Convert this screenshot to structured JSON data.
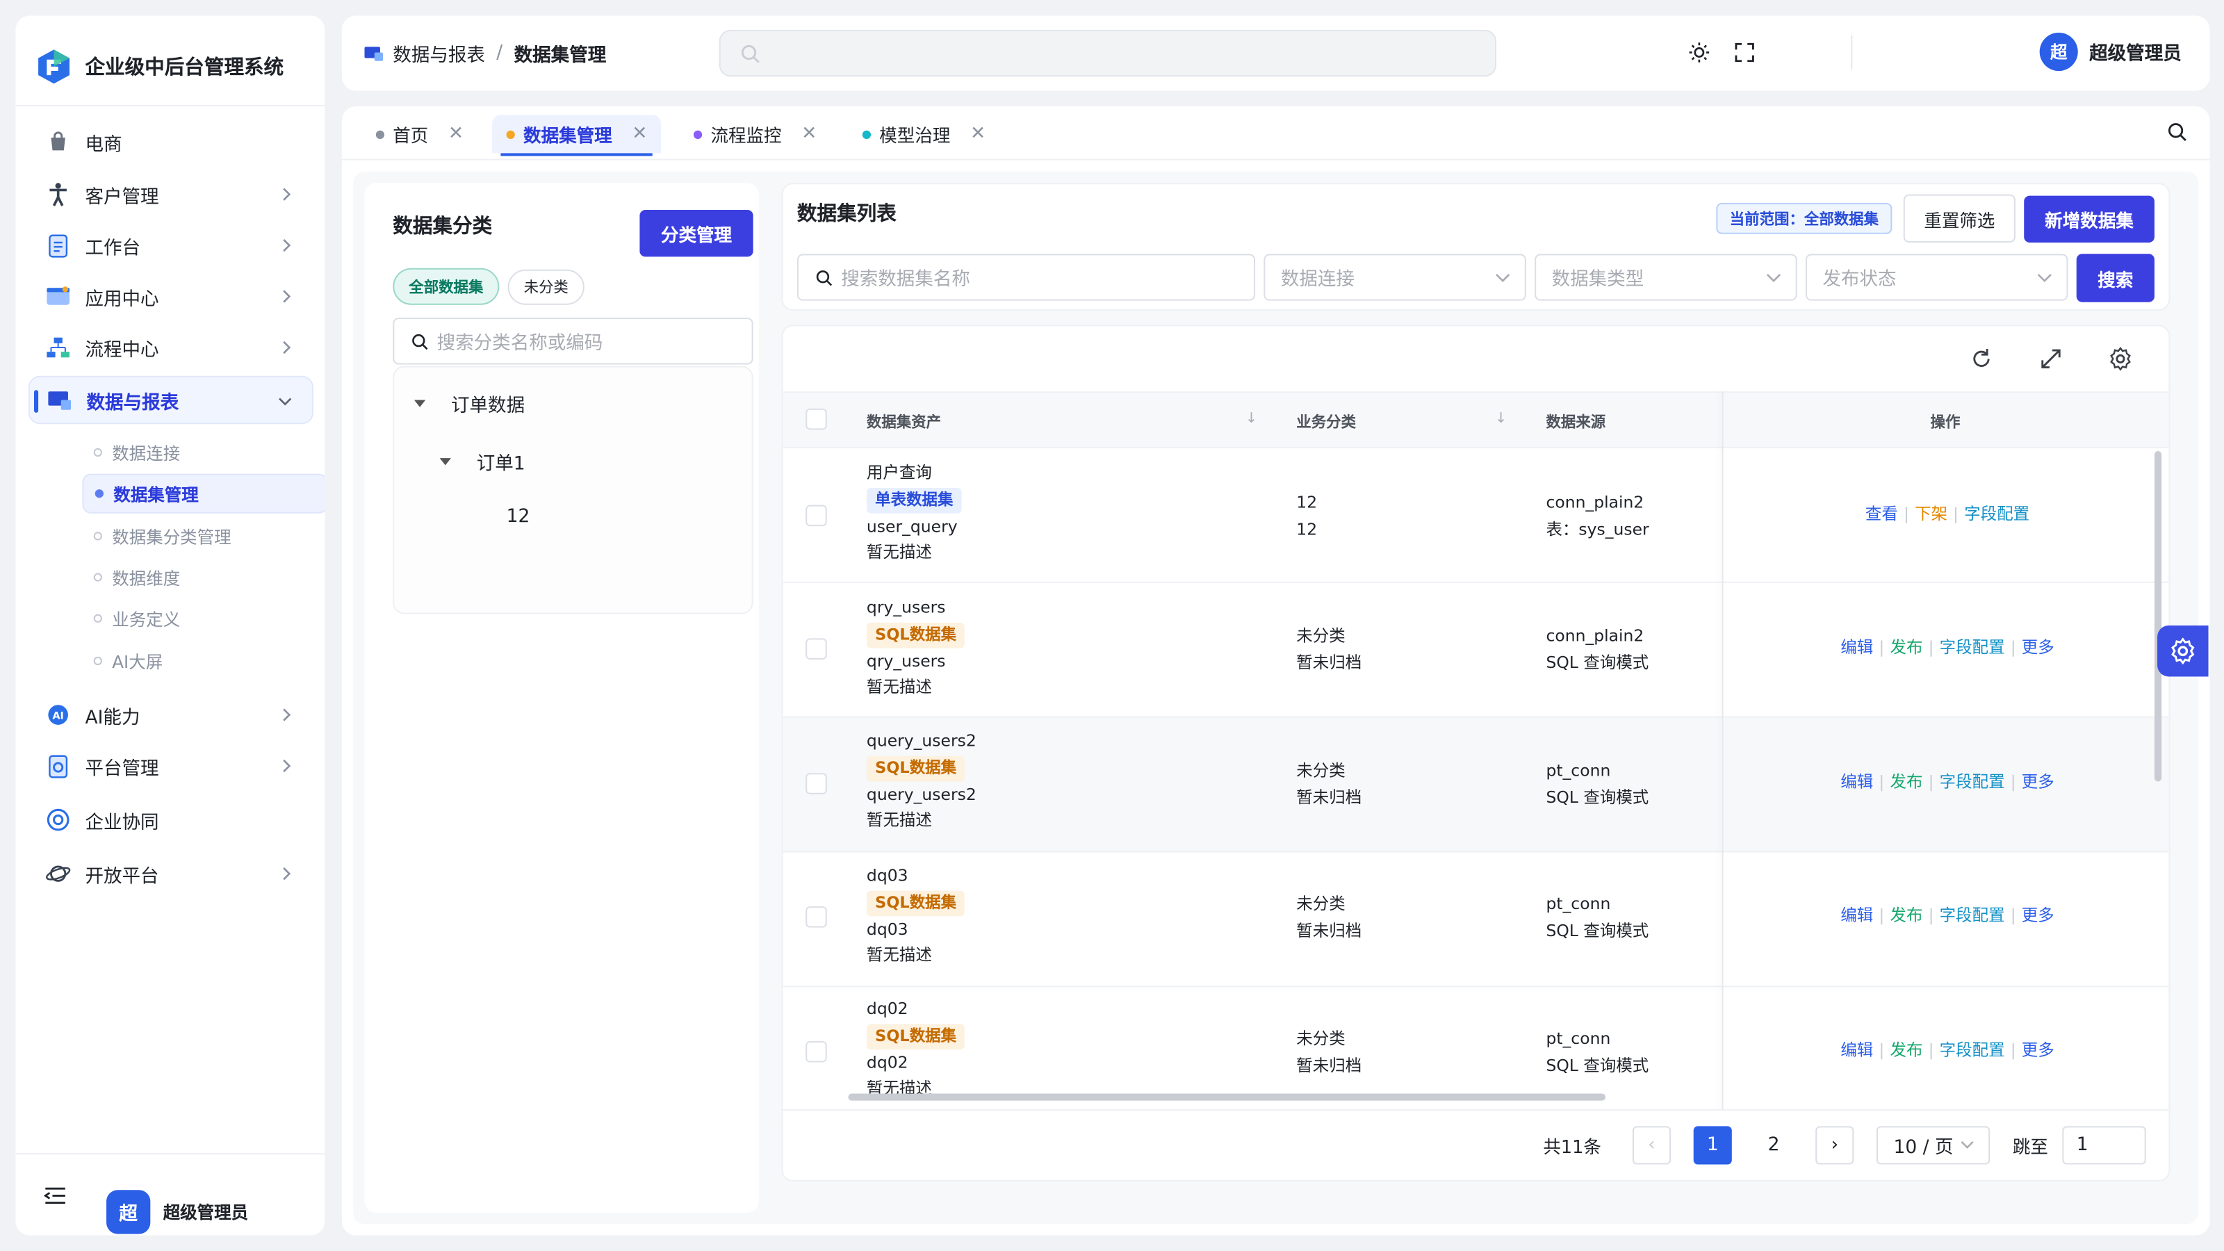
{
  "app": {
    "title": "企业级中后台管理系统",
    "user": "超级管理员",
    "avatar": "超"
  },
  "sidebar": {
    "items": [
      {
        "label": "电商",
        "icon": "shopping-bag-icon"
      },
      {
        "label": "客户管理",
        "icon": "person-icon"
      },
      {
        "label": "工作台",
        "icon": "clipboard-icon"
      },
      {
        "label": "应用中心",
        "icon": "app-window-icon"
      },
      {
        "label": "流程中心",
        "icon": "flow-icon"
      },
      {
        "label": "数据与报表",
        "icon": "report-icon"
      },
      {
        "label": "AI能力",
        "icon": "ai-icon"
      },
      {
        "label": "平台管理",
        "icon": "platform-icon"
      },
      {
        "label": "企业协同",
        "icon": "collab-icon"
      },
      {
        "label": "开放平台",
        "icon": "planet-icon"
      }
    ],
    "sub_items": [
      "数据连接",
      "数据集管理",
      "数据集分类管理",
      "数据维度",
      "业务定义",
      "AI大屏"
    ]
  },
  "header": {
    "breadcrumb": [
      "数据与报表",
      "数据集管理"
    ]
  },
  "tabs": [
    {
      "label": "首页",
      "color": "#8a919f"
    },
    {
      "label": "数据集管理",
      "color": "#f5a623"
    },
    {
      "label": "流程监控",
      "color": "#8b5cf6"
    },
    {
      "label": "模型治理",
      "color": "#14b8c8"
    }
  ],
  "category": {
    "title": "数据集分类",
    "manage_btn": "分类管理",
    "filters": [
      "全部数据集",
      "未分类"
    ],
    "search_placeholder": "搜索分类名称或编码",
    "tree": [
      "订单数据",
      "订单1",
      "12"
    ]
  },
  "list": {
    "title": "数据集列表",
    "scope": "当前范围：全部数据集",
    "reset_btn": "重置筛选",
    "add_btn": "新增数据集",
    "search_placeholder": "搜索数据集名称",
    "filters": [
      "数据连接",
      "数据集类型",
      "发布状态"
    ],
    "search_btn": "搜索",
    "columns": [
      "数据集资产",
      "业务分类",
      "数据来源",
      "操作"
    ],
    "rows": [
      {
        "name": "用户查询",
        "tag": "单表数据集",
        "code": "user_query",
        "desc": "暂无描述",
        "cat1": "12",
        "cat2": "12",
        "src1": "conn_plain2",
        "src2": "表：sys_user",
        "ops": [
          "查看",
          "下架",
          "字段配置"
        ]
      },
      {
        "name": "qry_users",
        "tag": "SQL数据集",
        "code": "qry_users",
        "desc": "暂无描述",
        "cat1": "未分类",
        "cat2": "暂未归档",
        "src1": "conn_plain2",
        "src2": "SQL 查询模式",
        "ops": [
          "编辑",
          "发布",
          "字段配置",
          "更多"
        ]
      },
      {
        "name": "query_users2",
        "tag": "SQL数据集",
        "code": "query_users2",
        "desc": "暂无描述",
        "cat1": "未分类",
        "cat2": "暂未归档",
        "src1": "pt_conn",
        "src2": "SQL 查询模式",
        "ops": [
          "编辑",
          "发布",
          "字段配置",
          "更多"
        ]
      },
      {
        "name": "dq03",
        "tag": "SQL数据集",
        "code": "dq03",
        "desc": "暂无描述",
        "cat1": "未分类",
        "cat2": "暂未归档",
        "src1": "pt_conn",
        "src2": "SQL 查询模式",
        "ops": [
          "编辑",
          "发布",
          "字段配置",
          "更多"
        ]
      },
      {
        "name": "dq02",
        "tag": "SQL数据集",
        "code": "dq02",
        "desc": "暂无描述",
        "cat1": "未分类",
        "cat2": "暂未归档",
        "src1": "pt_conn",
        "src2": "SQL 查询模式",
        "ops": [
          "编辑",
          "发布",
          "字段配置",
          "更多"
        ]
      }
    ],
    "pager": {
      "total": "共11条",
      "pages": [
        "1",
        "2"
      ],
      "size": "10 / 页",
      "jump_label": "跳至",
      "jump_value": "1"
    }
  },
  "colors": {
    "primary": "#3c3fe0",
    "link": "#2b5fe8",
    "warn": "#e38800",
    "success": "#13a66b"
  }
}
